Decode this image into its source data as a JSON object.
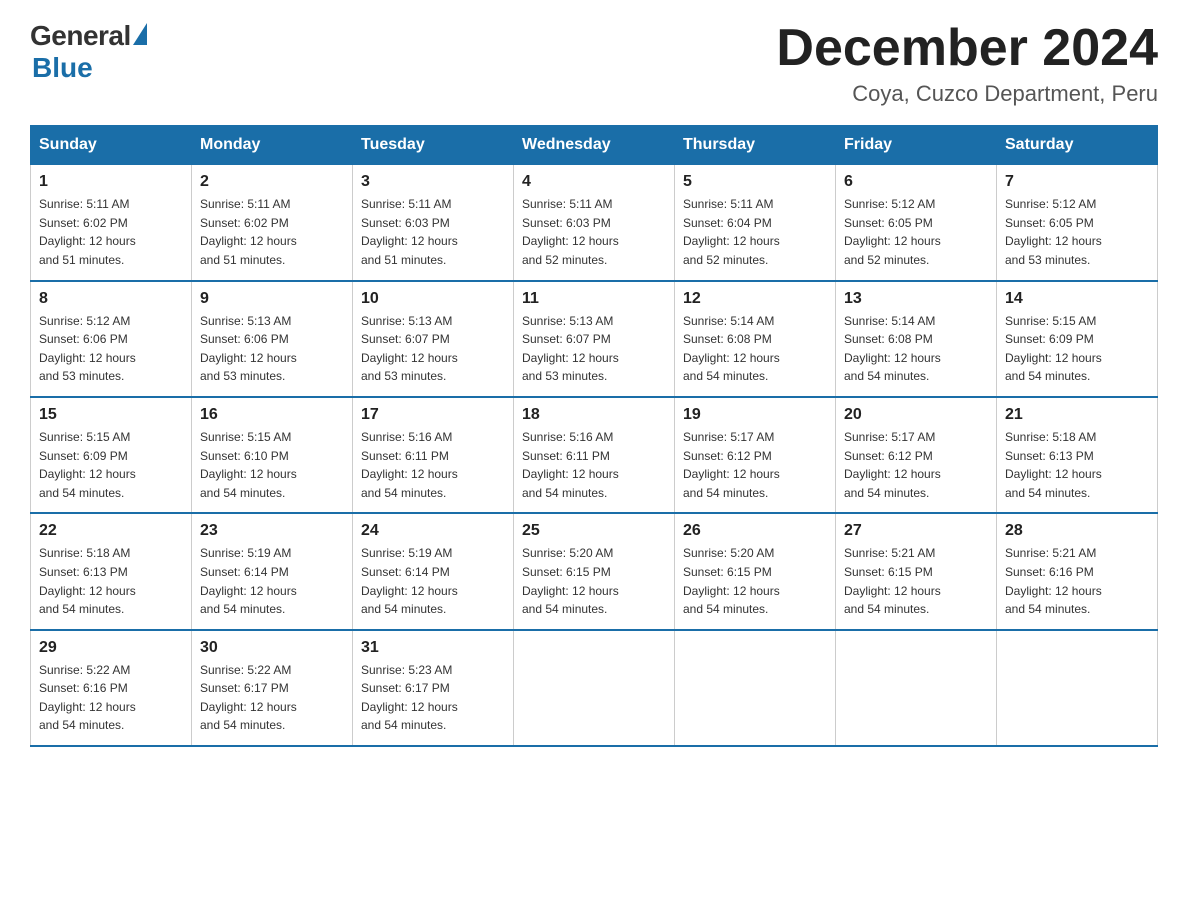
{
  "logo": {
    "general": "General",
    "blue": "Blue"
  },
  "title": "December 2024",
  "location": "Coya, Cuzco Department, Peru",
  "weekdays": [
    "Sunday",
    "Monday",
    "Tuesday",
    "Wednesday",
    "Thursday",
    "Friday",
    "Saturday"
  ],
  "weeks": [
    [
      {
        "day": "1",
        "sunrise": "5:11 AM",
        "sunset": "6:02 PM",
        "daylight": "12 hours and 51 minutes."
      },
      {
        "day": "2",
        "sunrise": "5:11 AM",
        "sunset": "6:02 PM",
        "daylight": "12 hours and 51 minutes."
      },
      {
        "day": "3",
        "sunrise": "5:11 AM",
        "sunset": "6:03 PM",
        "daylight": "12 hours and 51 minutes."
      },
      {
        "day": "4",
        "sunrise": "5:11 AM",
        "sunset": "6:03 PM",
        "daylight": "12 hours and 52 minutes."
      },
      {
        "day": "5",
        "sunrise": "5:11 AM",
        "sunset": "6:04 PM",
        "daylight": "12 hours and 52 minutes."
      },
      {
        "day": "6",
        "sunrise": "5:12 AM",
        "sunset": "6:05 PM",
        "daylight": "12 hours and 52 minutes."
      },
      {
        "day": "7",
        "sunrise": "5:12 AM",
        "sunset": "6:05 PM",
        "daylight": "12 hours and 53 minutes."
      }
    ],
    [
      {
        "day": "8",
        "sunrise": "5:12 AM",
        "sunset": "6:06 PM",
        "daylight": "12 hours and 53 minutes."
      },
      {
        "day": "9",
        "sunrise": "5:13 AM",
        "sunset": "6:06 PM",
        "daylight": "12 hours and 53 minutes."
      },
      {
        "day": "10",
        "sunrise": "5:13 AM",
        "sunset": "6:07 PM",
        "daylight": "12 hours and 53 minutes."
      },
      {
        "day": "11",
        "sunrise": "5:13 AM",
        "sunset": "6:07 PM",
        "daylight": "12 hours and 53 minutes."
      },
      {
        "day": "12",
        "sunrise": "5:14 AM",
        "sunset": "6:08 PM",
        "daylight": "12 hours and 54 minutes."
      },
      {
        "day": "13",
        "sunrise": "5:14 AM",
        "sunset": "6:08 PM",
        "daylight": "12 hours and 54 minutes."
      },
      {
        "day": "14",
        "sunrise": "5:15 AM",
        "sunset": "6:09 PM",
        "daylight": "12 hours and 54 minutes."
      }
    ],
    [
      {
        "day": "15",
        "sunrise": "5:15 AM",
        "sunset": "6:09 PM",
        "daylight": "12 hours and 54 minutes."
      },
      {
        "day": "16",
        "sunrise": "5:15 AM",
        "sunset": "6:10 PM",
        "daylight": "12 hours and 54 minutes."
      },
      {
        "day": "17",
        "sunrise": "5:16 AM",
        "sunset": "6:11 PM",
        "daylight": "12 hours and 54 minutes."
      },
      {
        "day": "18",
        "sunrise": "5:16 AM",
        "sunset": "6:11 PM",
        "daylight": "12 hours and 54 minutes."
      },
      {
        "day": "19",
        "sunrise": "5:17 AM",
        "sunset": "6:12 PM",
        "daylight": "12 hours and 54 minutes."
      },
      {
        "day": "20",
        "sunrise": "5:17 AM",
        "sunset": "6:12 PM",
        "daylight": "12 hours and 54 minutes."
      },
      {
        "day": "21",
        "sunrise": "5:18 AM",
        "sunset": "6:13 PM",
        "daylight": "12 hours and 54 minutes."
      }
    ],
    [
      {
        "day": "22",
        "sunrise": "5:18 AM",
        "sunset": "6:13 PM",
        "daylight": "12 hours and 54 minutes."
      },
      {
        "day": "23",
        "sunrise": "5:19 AM",
        "sunset": "6:14 PM",
        "daylight": "12 hours and 54 minutes."
      },
      {
        "day": "24",
        "sunrise": "5:19 AM",
        "sunset": "6:14 PM",
        "daylight": "12 hours and 54 minutes."
      },
      {
        "day": "25",
        "sunrise": "5:20 AM",
        "sunset": "6:15 PM",
        "daylight": "12 hours and 54 minutes."
      },
      {
        "day": "26",
        "sunrise": "5:20 AM",
        "sunset": "6:15 PM",
        "daylight": "12 hours and 54 minutes."
      },
      {
        "day": "27",
        "sunrise": "5:21 AM",
        "sunset": "6:15 PM",
        "daylight": "12 hours and 54 minutes."
      },
      {
        "day": "28",
        "sunrise": "5:21 AM",
        "sunset": "6:16 PM",
        "daylight": "12 hours and 54 minutes."
      }
    ],
    [
      {
        "day": "29",
        "sunrise": "5:22 AM",
        "sunset": "6:16 PM",
        "daylight": "12 hours and 54 minutes."
      },
      {
        "day": "30",
        "sunrise": "5:22 AM",
        "sunset": "6:17 PM",
        "daylight": "12 hours and 54 minutes."
      },
      {
        "day": "31",
        "sunrise": "5:23 AM",
        "sunset": "6:17 PM",
        "daylight": "12 hours and 54 minutes."
      },
      null,
      null,
      null,
      null
    ]
  ],
  "labels": {
    "sunrise": "Sunrise:",
    "sunset": "Sunset:",
    "daylight": "Daylight:"
  }
}
